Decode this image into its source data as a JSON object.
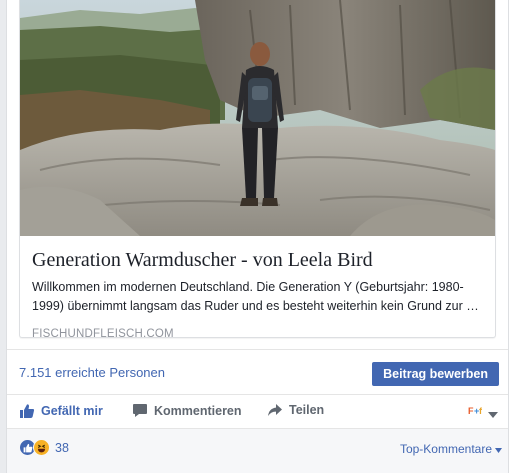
{
  "link_preview": {
    "title": "Generation Warmduscher - von Leela Bird",
    "description": "Willkommen im modernen Deutschland. Die Generation Y (Geburtsjahr: 1980-1999) übernimmt langsam das Ruder und es besteht weiterhin kein Grund zur …",
    "domain": "FISCHUNDFLEISCH.COM"
  },
  "reach": {
    "text": "7.151 erreichte Personen",
    "boost_label": "Beitrag bewerben"
  },
  "actions": {
    "like_label": "Gefällt mir",
    "comment_label": "Kommentieren",
    "share_label": "Teilen"
  },
  "reactions": {
    "count": "38",
    "sort_label": "Top-Kommentare"
  },
  "colors": {
    "link_blue": "#4267b2",
    "gray_text": "#606770",
    "muted": "#90949c",
    "haha_yellow": "#f7b125"
  }
}
